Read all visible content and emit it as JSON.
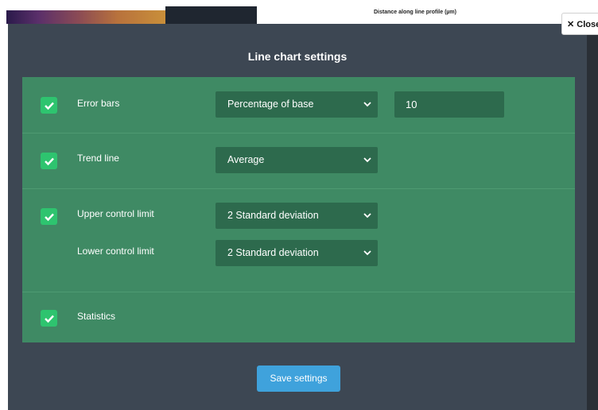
{
  "background": {
    "axis_title": "Distance along line profile (µm)"
  },
  "close_label": "Close",
  "modal": {
    "title": "Line chart settings",
    "rows": [
      {
        "label": "Error bars",
        "checked": true,
        "select": "Percentage of base",
        "value": "10"
      },
      {
        "label": "Trend line",
        "checked": true,
        "select": "Average"
      },
      {
        "label": "Upper control limit",
        "checked": true,
        "select": "2 Standard deviation"
      },
      {
        "label": "Lower control limit",
        "select": "2 Standard deviation"
      },
      {
        "label": "Statistics",
        "checked": true
      }
    ],
    "save_label": "Save settings"
  },
  "colors": {
    "modal_bg": "#3d4753",
    "panel_bg": "#3f8a64",
    "checkbox": "#2ec46f",
    "select_bg": "#2d6a4d",
    "save_button": "#3fa2dc"
  }
}
